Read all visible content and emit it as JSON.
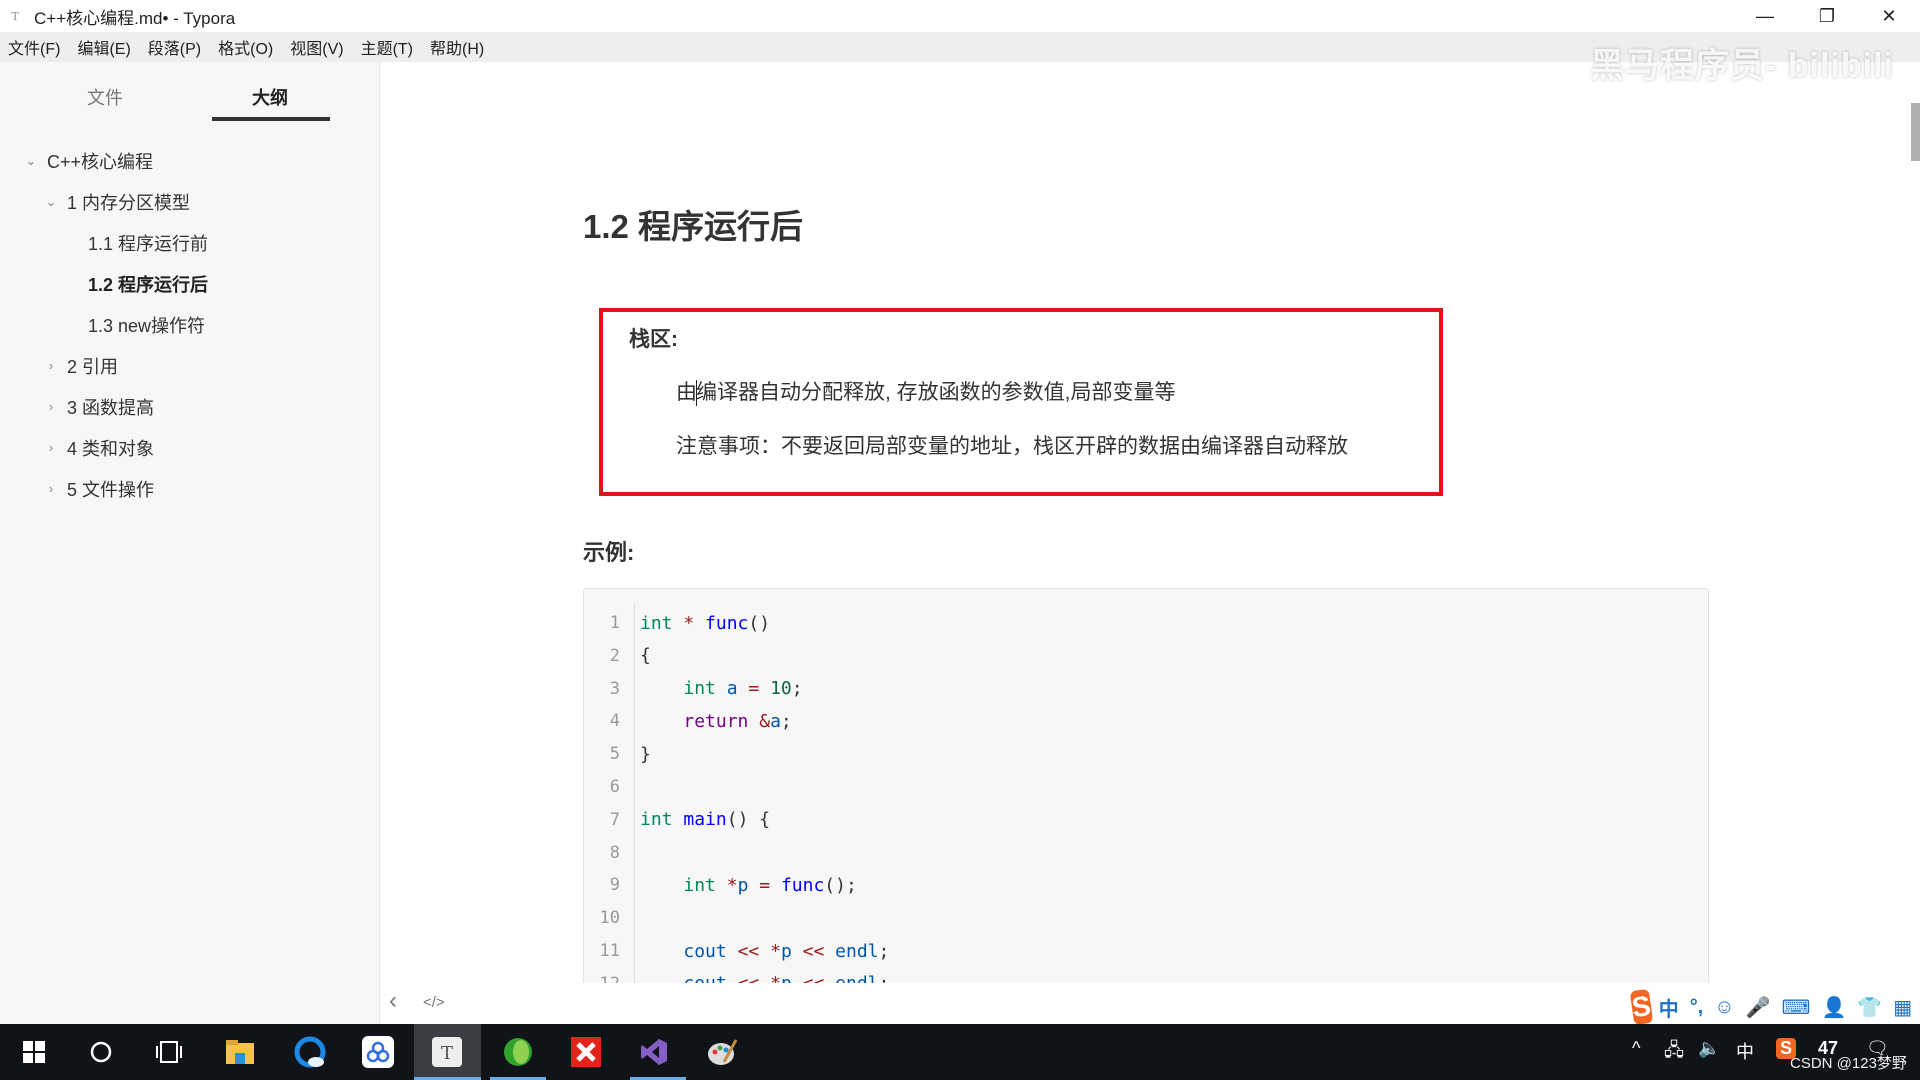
{
  "window": {
    "title": "C++核心编程.md• - Typora",
    "app_icon": "T",
    "controls": {
      "minimize": "—",
      "restore": "❐",
      "close": "✕"
    }
  },
  "menu": [
    "文件(F)",
    "编辑(E)",
    "段落(P)",
    "格式(O)",
    "视图(V)",
    "主题(T)",
    "帮助(H)"
  ],
  "watermark": "黑马程序员- bilibili",
  "sidebar": {
    "tabs": [
      {
        "label": "文件",
        "active": false
      },
      {
        "label": "大纲",
        "active": true
      }
    ],
    "outline": [
      {
        "label": "C++核心编程",
        "level": 1,
        "chevron": "⌄",
        "active": false
      },
      {
        "label": "1 内存分区模型",
        "level": 2,
        "chevron": "⌄",
        "active": false
      },
      {
        "label": "1.1 程序运行前",
        "level": 3,
        "chevron": "",
        "active": false
      },
      {
        "label": "1.2 程序运行后",
        "level": 3,
        "chevron": "",
        "active": true
      },
      {
        "label": "1.3 new操作符",
        "level": 3,
        "chevron": "",
        "active": false
      },
      {
        "label": "2 引用",
        "level": 2,
        "chevron": "›",
        "active": false
      },
      {
        "label": "3 函数提高",
        "level": 2,
        "chevron": "›",
        "active": false
      },
      {
        "label": "4 类和对象",
        "level": 2,
        "chevron": "›",
        "active": false
      },
      {
        "label": "5 文件操作",
        "level": 2,
        "chevron": "›",
        "active": false
      }
    ]
  },
  "document": {
    "heading": "1.2 程序运行后",
    "highlight_color": "#e0141c",
    "stack": {
      "title": "栈区:",
      "line1_first_char": "由",
      "line1_rest": "编译器自动分配释放, 存放函数的参数值,局部变量等",
      "line2": "注意事项：不要返回局部变量的地址，栈区开辟的数据由编译器自动释放"
    },
    "example_title": "示例:",
    "code_lines": [
      "int * func()",
      "{",
      "    int a = 10;",
      "    return &a;",
      "}",
      "",
      "int main() {",
      "",
      "    int *p = func();",
      "",
      "    cout << *p << endl;",
      "    cout << *p << endl;"
    ]
  },
  "footer": {
    "back_icon": "‹",
    "source_icon": "</>"
  },
  "ime": {
    "items": [
      "中",
      "°,",
      "☺",
      "🎤",
      "⌨",
      "👤",
      "👕",
      "▦"
    ]
  },
  "taskbar": {
    "apps": [
      "windows-start",
      "search",
      "task-view",
      "file-explorer",
      "browser",
      "baidu-netdisk",
      "typora",
      "green-app",
      "xmind",
      "visual-studio",
      "paint"
    ],
    "tray": {
      "chevron": "^",
      "network": "🖧",
      "volume": "🔈",
      "ime": "中",
      "sogou": "S",
      "counter": "47",
      "notification": "🗨"
    }
  },
  "overlay_text": "CSDN @123梦野"
}
